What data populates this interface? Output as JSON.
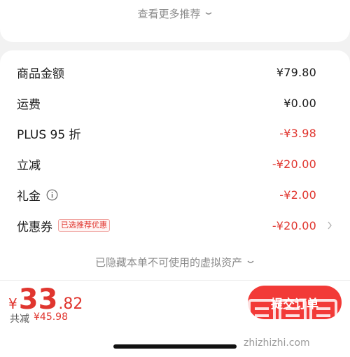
{
  "top": {
    "more_recommend": "查看更多推荐"
  },
  "summary": {
    "rows": [
      {
        "label": "商品金额",
        "value": "¥79.80"
      },
      {
        "label": "运费",
        "value": "¥0.00"
      },
      {
        "label": "PLUS 95 折",
        "value": "-¥3.98"
      },
      {
        "label": "立减",
        "value": "-¥20.00"
      },
      {
        "label": "礼金",
        "value": "-¥2.00"
      },
      {
        "label": "优惠券",
        "tag": "已选推荐优惠",
        "value": "-¥20.00"
      }
    ],
    "hidden_assets": "已隐藏本单不可使用的虚拟资产"
  },
  "bottom": {
    "currency": "¥",
    "price_int": "33",
    "price_dec": ".82",
    "saved_label": "共减",
    "saved_amount": "¥45.98",
    "submit_label": "提交订单"
  },
  "watermark": {
    "text": "zhizhizhi.com"
  },
  "colors": {
    "accent": "#e0362f",
    "button": "#f23a37"
  }
}
